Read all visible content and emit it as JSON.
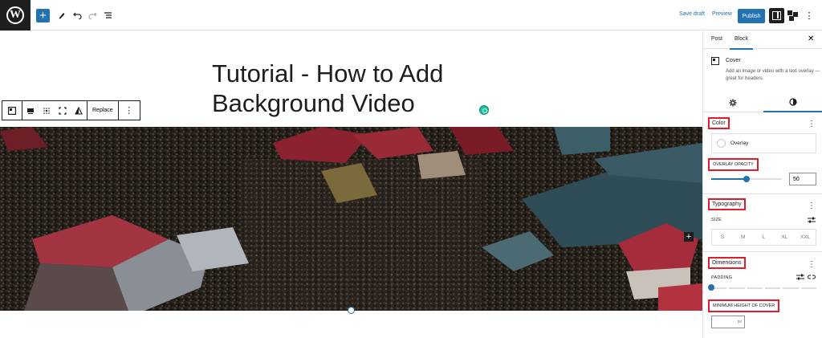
{
  "topbar": {
    "save_draft": "Save draft",
    "preview": "Preview",
    "publish": "Publish",
    "icons": [
      "wordpress-logo",
      "plus-icon",
      "pencil-icon",
      "undo-icon",
      "redo-icon",
      "list-view-icon",
      "settings-icon",
      "jetpack-icon",
      "more-vertical-icon"
    ]
  },
  "canvas": {
    "title": "Tutorial - How to Add Background Video",
    "block_toolbar": {
      "replace": "Replace"
    }
  },
  "sidebar": {
    "tabs": {
      "post": "Post",
      "block": "Block"
    },
    "block": {
      "name": "Cover",
      "description": "Add an image or video with a text overlay — great for headers."
    },
    "color": {
      "title": "Color",
      "overlay": "Overlay"
    },
    "overlay_opacity": {
      "label": "OVERLAY OPACITY",
      "value": "50",
      "fraction": 0.5
    },
    "typography": {
      "title": "Typography",
      "size_label": "SIZE",
      "sizes": [
        "S",
        "M",
        "L",
        "XL",
        "XXL"
      ]
    },
    "dimensions": {
      "title": "Dimensions",
      "padding_label": "PADDING",
      "min_height_label": "MINIMUM HEIGHT OF COVER",
      "min_height_unit": "px"
    }
  },
  "colors": {
    "accent": "#2271b1",
    "highlight_border": "#e11d2c",
    "dark": "#1e1e1e"
  }
}
